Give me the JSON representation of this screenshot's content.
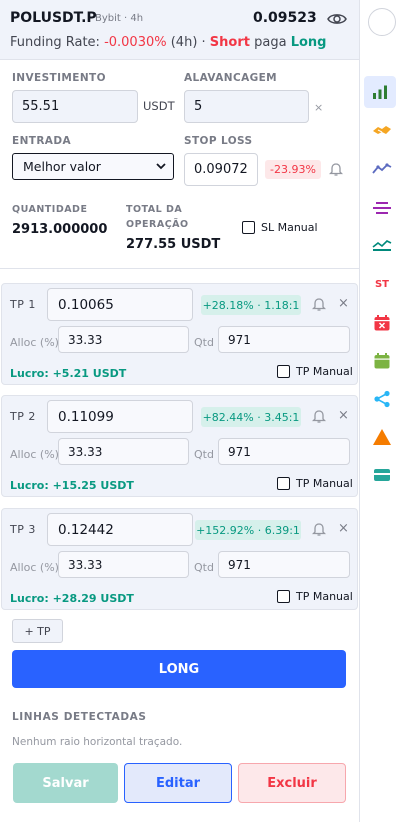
{
  "header": {
    "symbol": "POLUSDT.P",
    "exchange": "Bybit · 4h",
    "price": "0.09523",
    "funding_label": "Funding Rate:",
    "funding_value": "-0.0030%",
    "funding_period": "(4h) ·",
    "short_label": "Short",
    "pays_label": "paga",
    "long_label": "Long"
  },
  "form": {
    "investimento_label": "INVESTIMENTO",
    "investimento_value": "55.51",
    "investimento_unit": "USDT",
    "alavancagem_label": "ALAVANCAGEM",
    "alavancagem_value": "5",
    "alavancagem_unit": "×",
    "entrada_label": "ENTRADA",
    "entrada_value": "Melhor valor",
    "stop_loss_label": "STOP LOSS",
    "stop_loss_value": "0.09072",
    "stop_loss_pct": "-23.93%",
    "quantidade_label": "QUANTIDADE",
    "quantidade_value": "2913.000000",
    "total_label_1": "TOTAL DA",
    "total_label_2": "OPERAÇÃO",
    "total_value": "277.55 USDT",
    "sl_manual_label": "SL Manual"
  },
  "tps": [
    {
      "label": "TP 1",
      "price": "0.10065",
      "pill": "+28.18% · 1.18:1",
      "alloc_label": "Alloc (%)",
      "alloc": "33.33",
      "qtd_label": "Qtd",
      "qtd": "971",
      "lucro": "Lucro: +5.21 USDT",
      "manual_label": "TP Manual"
    },
    {
      "label": "TP 2",
      "price": "0.11099",
      "pill": "+82.44% · 3.45:1",
      "alloc_label": "Alloc (%)",
      "alloc": "33.33",
      "qtd_label": "Qtd",
      "qtd": "971",
      "lucro": "Lucro: +15.25 USDT",
      "manual_label": "TP Manual"
    },
    {
      "label": "TP 3",
      "price": "0.12442",
      "pill": "+152.92% · 6.39:1",
      "alloc_label": "Alloc (%)",
      "alloc": "33.33",
      "qtd_label": "Qtd",
      "qtd": "971",
      "lucro": "Lucro: +28.29 USDT",
      "manual_label": "TP Manual"
    }
  ],
  "actions": {
    "add_tp": "+ TP",
    "long": "LONG",
    "linhas_label": "LINHAS DETECTADAS",
    "linhas_empty": "Nenhum raio horizontal traçado.",
    "save": "Salvar",
    "edit": "Editar",
    "delete": "Excluir"
  },
  "toolbar": {
    "icons": [
      "avatar-circle",
      "bar-chart-icon",
      "handshake-icon",
      "trend-line-icon",
      "horizontal-lines-icon",
      "area-chart-icon",
      "st-indicator-icon",
      "calendar-x-icon",
      "calendar-icon",
      "share-icon",
      "warning-triangle-icon",
      "card-icon"
    ],
    "st_label": "ST"
  },
  "colors": {
    "accent": "#2962ff",
    "green": "#089981",
    "red": "#f23645",
    "orange": "#f57c00",
    "purple": "#9c27b0"
  }
}
